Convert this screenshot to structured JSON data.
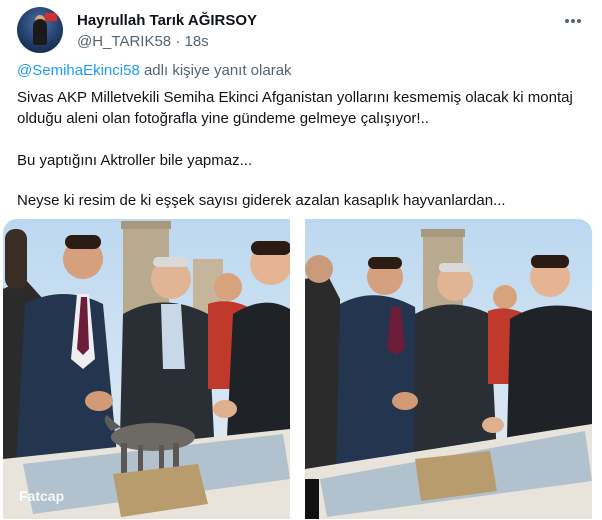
{
  "author": {
    "name": "Hayrullah Tarık AĞIRSOY",
    "handle": "@H_TARIK58",
    "separator": "·",
    "time": "18s"
  },
  "more_icon": "more-horizontal-icon",
  "reply": {
    "mention": "@SemihaEkinci58",
    "suffix": " adlı kişiye yanıt olarak"
  },
  "tweet_text": {
    "paragraph1": "Sivas AKP Milletvekili Semiha Ekinci Afganistan yollarını kesmemiş olacak ki montaj olduğu aleni olan fotoğrafla yine gündeme gelmeye çalışıyor!..",
    "paragraph2": "Bu yaptığını Aktroller bile yapmaz...",
    "paragraph3": "Neyse ki resim de ki eşşek sayısı giderek azalan kasaplık hayvanlardan..."
  },
  "media": {
    "count": 2,
    "left_sign": "Fatcap"
  },
  "colors": {
    "text": "#0f1419",
    "secondary": "#536471",
    "link": "#1d9bf0"
  }
}
